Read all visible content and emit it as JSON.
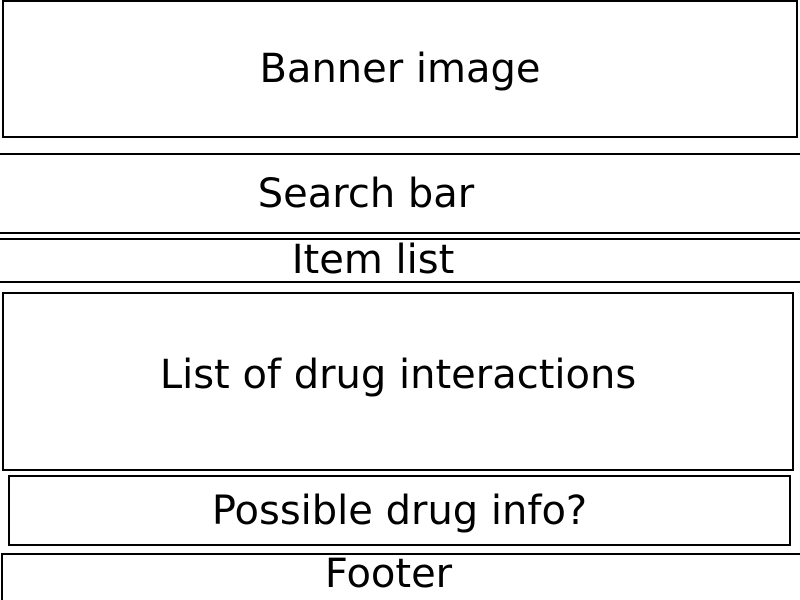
{
  "wireframe": {
    "banner": {
      "label": "Banner image"
    },
    "search_bar": {
      "label": "Search bar"
    },
    "item_list": {
      "label": "Item list"
    },
    "drug_interactions": {
      "label": "List of drug interactions"
    },
    "drug_info": {
      "label": "Possible drug info?"
    },
    "footer": {
      "label": "Footer"
    }
  },
  "colors": {
    "border": "#000000",
    "background": "#ffffff",
    "text": "#000000"
  }
}
